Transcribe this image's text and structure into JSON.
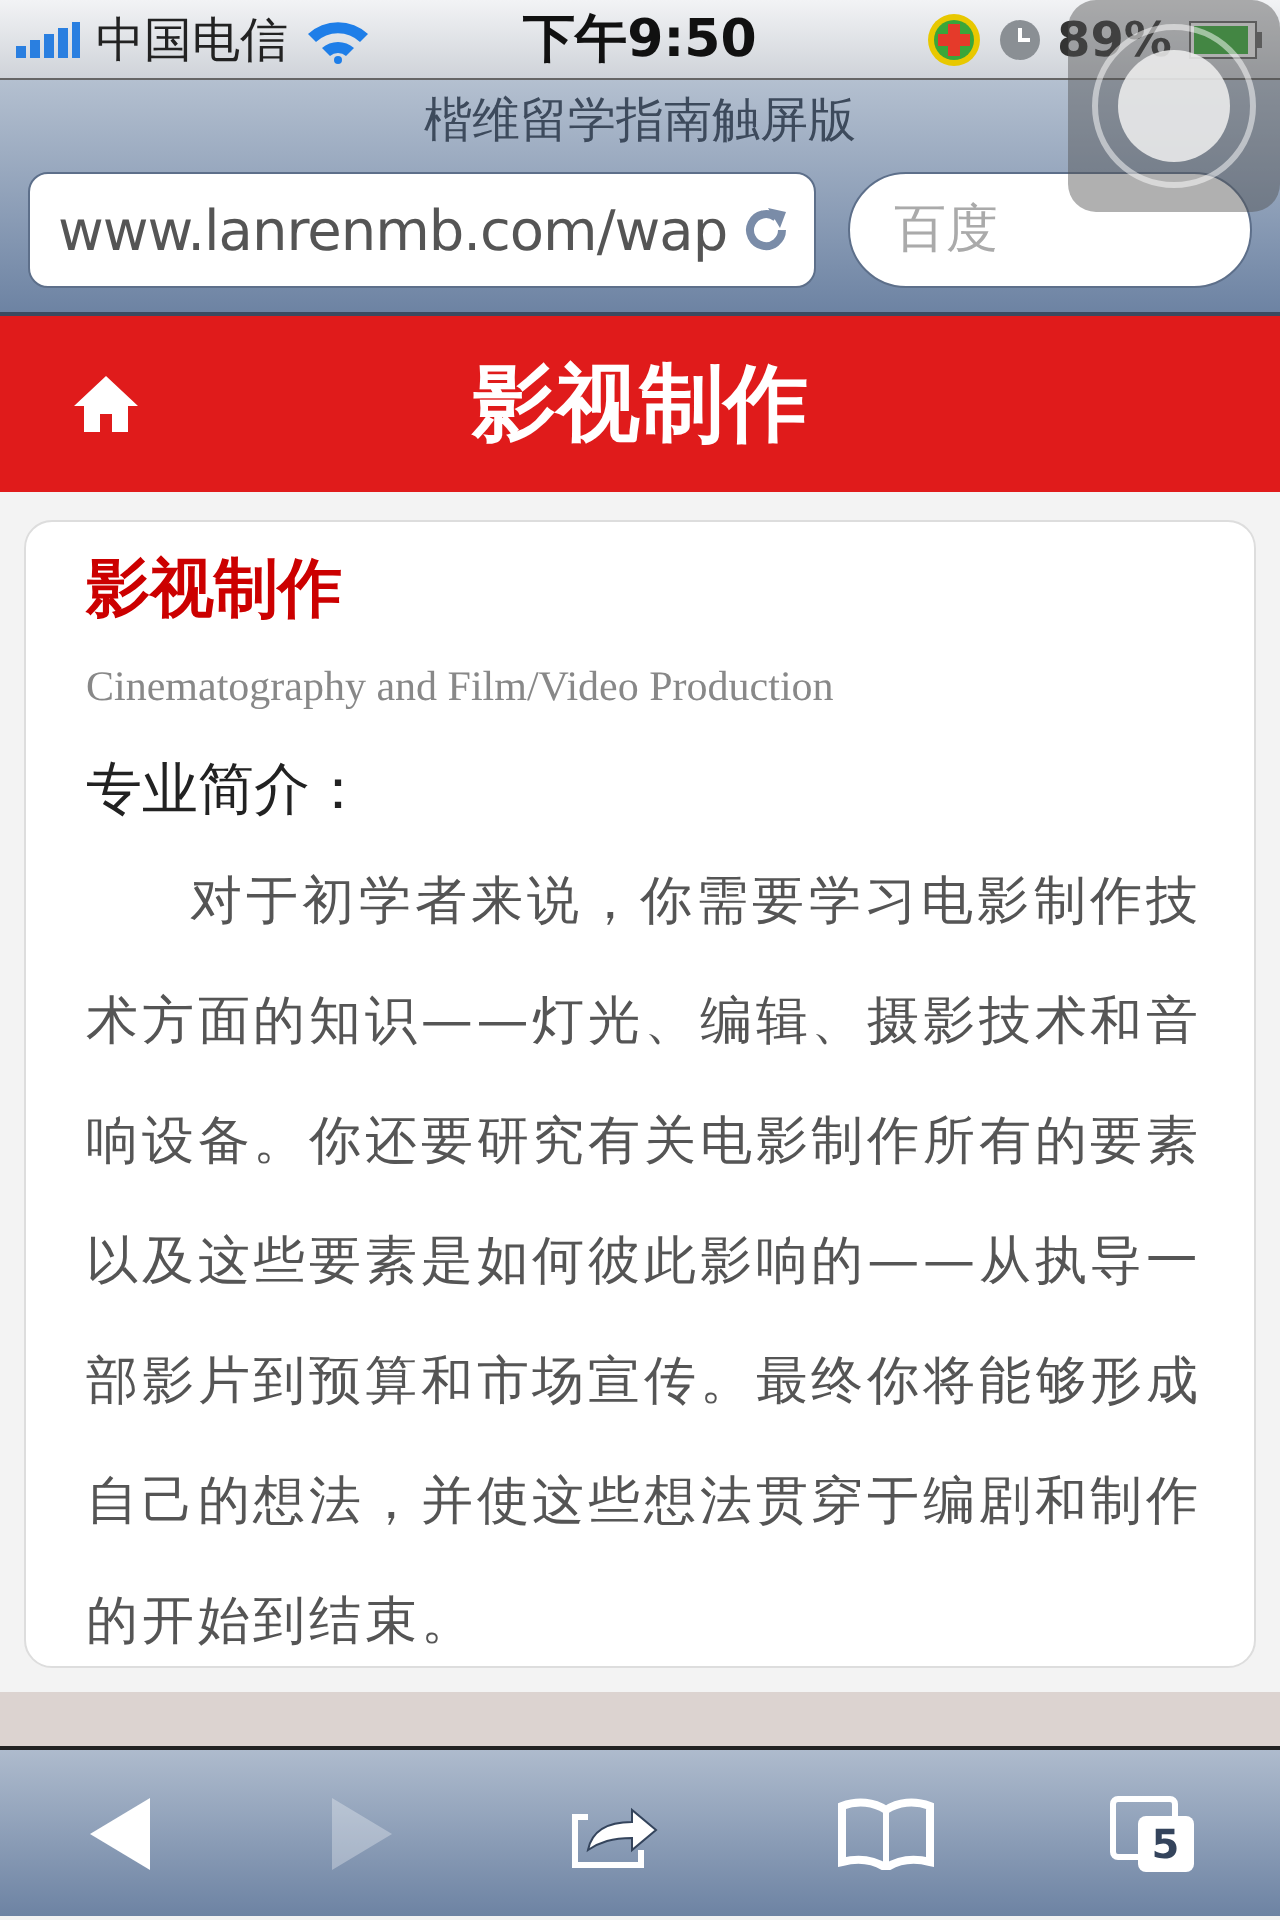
{
  "status_bar": {
    "carrier": "中国电信",
    "time": "下午9:50",
    "battery": "89%"
  },
  "browser": {
    "title": "楷维留学指南触屏版",
    "url": "www.lanrenmb.com/wap",
    "search": {
      "placeholder": "百度"
    }
  },
  "header": {
    "title": "影视制作"
  },
  "article": {
    "title": "影视制作",
    "subtitle": "Cinematography and Film/Video Production",
    "section": "专业简介：",
    "paragraph": "对于初学者来说，你需要学习电影制作技术方面的知识——灯光、编辑、摄影技术和音响设备。你还要研究有关电影制作所有的要素以及这些要素是如何彼此影响的——从执导一部影片到预算和市场宣传。最终你将能够形成自己的想法，并使这些想法贯穿于编剧和制作的开始到结束。"
  },
  "toolbar": {
    "back": {
      "disabled": false
    },
    "forward": {
      "disabled": true
    },
    "tabs_count": "5"
  }
}
